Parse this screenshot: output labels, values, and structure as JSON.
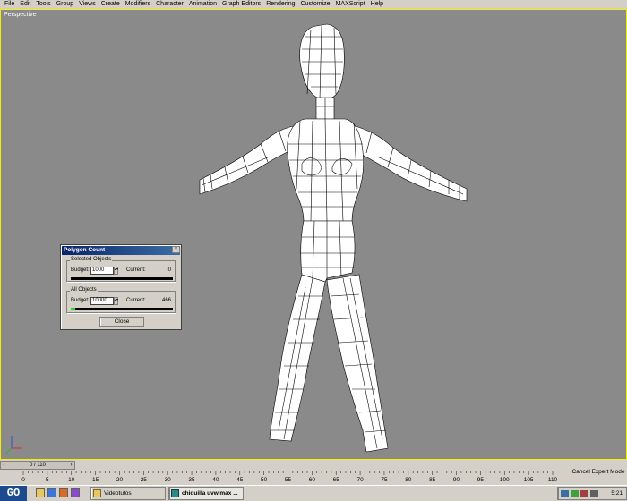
{
  "menubar": {
    "items": [
      "File",
      "Edit",
      "Tools",
      "Group",
      "Views",
      "Create",
      "Modifiers",
      "Character",
      "Animation",
      "Graph Editors",
      "Rendering",
      "Customize",
      "MAXScript",
      "Help"
    ]
  },
  "viewport": {
    "label": "Perspective",
    "border_color": "#f0f000",
    "background_color": "#8a8a8a"
  },
  "polygon_count": {
    "title": "Polygon Count",
    "close_glyph": "x",
    "selected_objects": {
      "label": "Selected Objects",
      "budget_label": "Budget:",
      "budget_value": "1000",
      "current_label": "Current:",
      "current_value": "0",
      "fill_fraction": 0.0
    },
    "all_objects": {
      "label": "All Objects",
      "budget_label": "Budget:",
      "budget_value": "10000",
      "current_label": "Current:",
      "current_value": "466",
      "fill_fraction": 0.0466
    },
    "close_button": "Close",
    "bar_fill_color": "#2bd12b"
  },
  "timeline": {
    "slider_label": "0 / 110",
    "ticks": [
      "0",
      "5",
      "10",
      "15",
      "20",
      "25",
      "30",
      "35",
      "40",
      "45",
      "50",
      "55",
      "60",
      "65",
      "70",
      "75",
      "80",
      "85",
      "90",
      "95",
      "100",
      "105",
      "110"
    ],
    "expert_mode_button": "Cancel Expert Mode"
  },
  "taskbar": {
    "start_label": "GO",
    "tasks": [
      {
        "label": "Videotutos",
        "icon": "folder-icon"
      },
      {
        "label": "chiquilla uvw.max ...",
        "icon": "3dsmax-icon"
      }
    ],
    "clock": "5:21"
  }
}
